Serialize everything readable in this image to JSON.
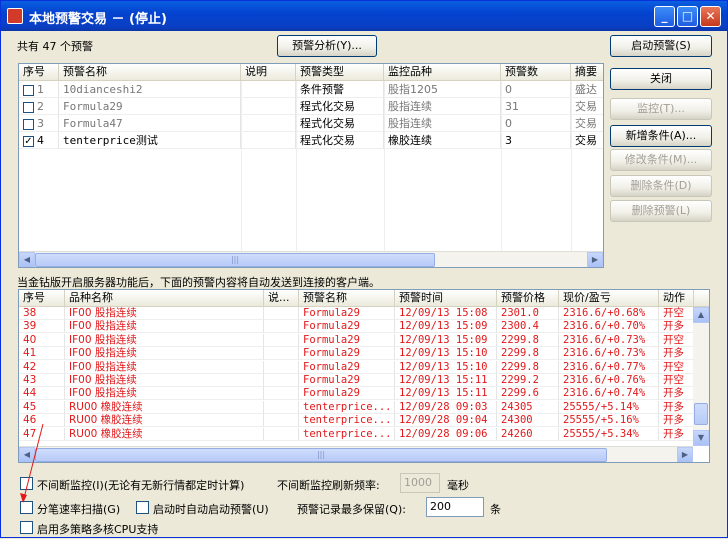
{
  "window": {
    "title": "本地预警交易 － (停止)",
    "min": "_",
    "max": "□",
    "close": "✕"
  },
  "summary": "共有 47 个预警",
  "buttons": {
    "analysis": "预警分析(Y)...",
    "start": "启动预警(S)",
    "close": "关闭",
    "monitor": "监控(T)...",
    "add": "新增条件(A)...",
    "modify": "修改条件(M)...",
    "delete_cond": "删除条件(D)",
    "delete_alert": "删除预警(L)"
  },
  "top_table": {
    "headers": [
      "序号",
      "预警名称",
      "说明",
      "预警类型",
      "监控品种",
      "预警数",
      "摘要"
    ],
    "rows": [
      {
        "checked": false,
        "no": "1",
        "name": "10dianceshi2",
        "desc": "",
        "type": "条件预警",
        "symbol": "股指1205",
        "count": "0",
        "summary": "盛达"
      },
      {
        "checked": false,
        "no": "2",
        "name": "Formula29",
        "desc": "",
        "type": "程式化交易",
        "symbol": "股指连续",
        "count": "31",
        "summary": "交易"
      },
      {
        "checked": false,
        "no": "3",
        "name": "Formula47",
        "desc": "",
        "type": "程式化交易",
        "symbol": "股指连续",
        "count": "0",
        "summary": "交易"
      },
      {
        "checked": true,
        "no": "4",
        "name": "tenterprice测试",
        "desc": "",
        "type": "程式化交易",
        "symbol": "橡胶连续",
        "count": "3",
        "summary": "交易"
      }
    ]
  },
  "note": "当金钻版开启服务器功能后，下面的预警内容将自动发送到连接的客户端。",
  "bottom_table": {
    "headers": [
      "序号",
      "品种名称",
      "说...",
      "预警名称",
      "预警时间",
      "预警价格",
      "现价/盈亏",
      "动作"
    ],
    "rows": [
      [
        "38",
        "IF00 股指连续",
        "",
        "Formula29",
        "12/09/13 15:08",
        "2301.0",
        "2316.6/+0.68%",
        "开空"
      ],
      [
        "39",
        "IF00 股指连续",
        "",
        "Formula29",
        "12/09/13 15:09",
        "2300.4",
        "2316.6/+0.70%",
        "开多"
      ],
      [
        "40",
        "IF00 股指连续",
        "",
        "Formula29",
        "12/09/13 15:09",
        "2299.8",
        "2316.6/+0.73%",
        "开空"
      ],
      [
        "41",
        "IF00 股指连续",
        "",
        "Formula29",
        "12/09/13 15:10",
        "2299.8",
        "2316.6/+0.73%",
        "开多"
      ],
      [
        "42",
        "IF00 股指连续",
        "",
        "Formula29",
        "12/09/13 15:10",
        "2299.8",
        "2316.6/+0.77%",
        "开空"
      ],
      [
        "43",
        "IF00 股指连续",
        "",
        "Formula29",
        "12/09/13 15:11",
        "2299.2",
        "2316.6/+0.76%",
        "开空"
      ],
      [
        "44",
        "IF00 股指连续",
        "",
        "Formula29",
        "12/09/13 15:11",
        "2299.6",
        "2316.6/+0.74%",
        "开多"
      ],
      [
        "45",
        "RU00 橡胶连续",
        "",
        "tenterprice...",
        "12/09/28 09:03",
        "24305",
        "25555/+5.14%",
        "开多"
      ],
      [
        "46",
        "RU00 橡胶连续",
        "",
        "tenterprice...",
        "12/09/28 09:04",
        "24300",
        "25555/+5.16%",
        "开多"
      ],
      [
        "47",
        "RU00 橡胶连续",
        "",
        "tenterprice...",
        "12/09/28 09:06",
        "24260",
        "25555/+5.34%",
        "开多"
      ]
    ]
  },
  "options": {
    "continuous": "不间断监控(I)(无论有无新行情都定时计算)",
    "refresh_label": "不间断监控刷新频率:",
    "refresh_value": "1000",
    "refresh_unit": "毫秒",
    "tick_scan": "分笔速率扫描(G)",
    "autostart": "启动时自动启动预警(U)",
    "max_keep_label": "预警记录最多保留(Q):",
    "max_keep_value": "200",
    "max_keep_unit": "条",
    "multicore": "启用多策略多核CPU支持"
  },
  "colors": {
    "accent": "#0a5fe0",
    "alert": "#e2181a"
  }
}
